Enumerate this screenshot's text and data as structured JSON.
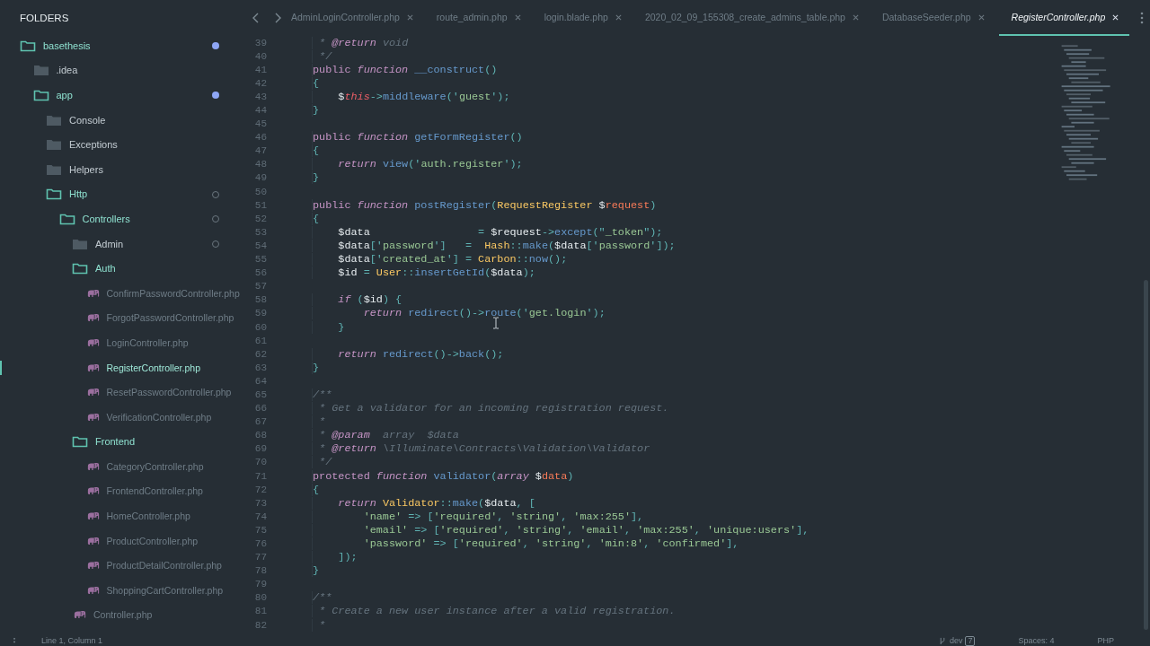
{
  "sidebar": {
    "title": "FOLDERS",
    "tree": [
      {
        "name": "basethesis",
        "kind": "folder",
        "expanded": true,
        "modified": true,
        "children": [
          {
            "name": ".idea",
            "kind": "folder",
            "expanded": false
          },
          {
            "name": "app",
            "kind": "folder",
            "expanded": true,
            "modified": true,
            "children": [
              {
                "name": "Console",
                "kind": "folder",
                "expanded": false
              },
              {
                "name": "Exceptions",
                "kind": "folder",
                "expanded": false
              },
              {
                "name": "Helpers",
                "kind": "folder",
                "expanded": false
              },
              {
                "name": "Http",
                "kind": "folder",
                "expanded": true,
                "modified": false,
                "children": [
                  {
                    "name": "Controllers",
                    "kind": "folder",
                    "expanded": true,
                    "modified": false,
                    "children": [
                      {
                        "name": "Admin",
                        "kind": "folder",
                        "expanded": false,
                        "modified": false
                      },
                      {
                        "name": "Auth",
                        "kind": "folder",
                        "expanded": true,
                        "children": [
                          {
                            "name": "ConfirmPasswordController.php",
                            "kind": "file",
                            "selected": false
                          },
                          {
                            "name": "ForgotPasswordController.php",
                            "kind": "file",
                            "selected": false
                          },
                          {
                            "name": "LoginController.php",
                            "kind": "file",
                            "selected": false
                          },
                          {
                            "name": "RegisterController.php",
                            "kind": "file",
                            "selected": true
                          },
                          {
                            "name": "ResetPasswordController.php",
                            "kind": "file",
                            "selected": false
                          },
                          {
                            "name": "VerificationController.php",
                            "kind": "file",
                            "selected": false
                          }
                        ]
                      },
                      {
                        "name": "Frontend",
                        "kind": "folder",
                        "expanded": true,
                        "children": [
                          {
                            "name": "CategoryController.php",
                            "kind": "file",
                            "selected": false
                          },
                          {
                            "name": "FrontendController.php",
                            "kind": "file",
                            "selected": false
                          },
                          {
                            "name": "HomeController.php",
                            "kind": "file",
                            "selected": false
                          },
                          {
                            "name": "ProductController.php",
                            "kind": "file",
                            "selected": false
                          },
                          {
                            "name": "ProductDetailController.php",
                            "kind": "file",
                            "selected": false
                          },
                          {
                            "name": "ShoppingCartController.php",
                            "kind": "file",
                            "selected": false
                          }
                        ]
                      },
                      {
                        "name": "Controller.php",
                        "kind": "file",
                        "selected": false
                      }
                    ]
                  }
                ]
              }
            ]
          }
        ]
      }
    ]
  },
  "tabs": [
    {
      "label": "AdminLoginController.php",
      "selected": false
    },
    {
      "label": "route_admin.php",
      "selected": false
    },
    {
      "label": "login.blade.php",
      "selected": false
    },
    {
      "label": "2020_02_09_155308_create_admins_table.php",
      "selected": false
    },
    {
      "label": "DatabaseSeeder.php",
      "selected": false
    },
    {
      "label": "RegisterController.php",
      "selected": true
    }
  ],
  "editor": {
    "lines": [
      {
        "number": "39",
        "tokens": [
          {
            "kind": "cmt",
            "text": " * "
          },
          {
            "kind": "tag",
            "text": "@return"
          },
          {
            "kind": "cmt",
            "text": " void"
          }
        ]
      },
      {
        "number": "40",
        "tokens": [
          {
            "kind": "cmt",
            "text": " */"
          }
        ]
      },
      {
        "number": "41",
        "tokens": [
          {
            "kind": "storage",
            "text": "public "
          },
          {
            "kind": "type",
            "text": "function"
          },
          {
            "kind": "fn",
            "text": " __construct"
          },
          {
            "kind": "op",
            "text": "()"
          }
        ]
      },
      {
        "number": "42",
        "tokens": [
          {
            "kind": "op",
            "text": "{"
          }
        ]
      },
      {
        "number": "43",
        "tokens": [
          {
            "kind": "var",
            "text": "    $"
          },
          {
            "kind": "this",
            "text": "this"
          },
          {
            "kind": "op",
            "text": "->"
          },
          {
            "kind": "fn",
            "text": "middleware"
          },
          {
            "kind": "op",
            "text": "('"
          },
          {
            "kind": "str",
            "text": "guest"
          },
          {
            "kind": "op",
            "text": "');"
          }
        ]
      },
      {
        "number": "44",
        "tokens": [
          {
            "kind": "op",
            "text": "}"
          }
        ]
      },
      {
        "number": "45"
      },
      {
        "number": "46",
        "tokens": [
          {
            "kind": "storage",
            "text": "public "
          },
          {
            "kind": "type",
            "text": "function"
          },
          {
            "kind": "fn",
            "text": " getFormRegister"
          },
          {
            "kind": "op",
            "text": "()"
          }
        ]
      },
      {
        "number": "47",
        "tokens": [
          {
            "kind": "op",
            "text": "{"
          }
        ]
      },
      {
        "number": "48",
        "tokens": [
          {
            "kind": "type",
            "text": "    return"
          },
          {
            "kind": "fn",
            "text": " view"
          },
          {
            "kind": "op",
            "text": "('"
          },
          {
            "kind": "str",
            "text": "auth.register"
          },
          {
            "kind": "op",
            "text": "');"
          }
        ]
      },
      {
        "number": "49",
        "tokens": [
          {
            "kind": "op",
            "text": "}"
          }
        ]
      },
      {
        "number": "50"
      },
      {
        "number": "51",
        "tokens": [
          {
            "kind": "storage",
            "text": "public "
          },
          {
            "kind": "type",
            "text": "function"
          },
          {
            "kind": "fn",
            "text": " postRegister"
          },
          {
            "kind": "op",
            "text": "("
          },
          {
            "kind": "cls",
            "text": "RequestRegister "
          },
          {
            "kind": "var",
            "text": "$"
          },
          {
            "kind": "param",
            "text": "request"
          },
          {
            "kind": "op",
            "text": ")"
          }
        ]
      },
      {
        "number": "52",
        "tokens": [
          {
            "kind": "op",
            "text": "{"
          }
        ]
      },
      {
        "number": "53",
        "tokens": [
          {
            "kind": "var",
            "text": "    $data                 "
          },
          {
            "kind": "op",
            "text": "= "
          },
          {
            "kind": "var",
            "text": "$request"
          },
          {
            "kind": "op",
            "text": "->"
          },
          {
            "kind": "fn",
            "text": "except"
          },
          {
            "kind": "op",
            "text": "(\""
          },
          {
            "kind": "str",
            "text": "_token"
          },
          {
            "kind": "op",
            "text": "\");"
          }
        ]
      },
      {
        "number": "54",
        "tokens": [
          {
            "kind": "var",
            "text": "    $data"
          },
          {
            "kind": "op",
            "text": "['"
          },
          {
            "kind": "str",
            "text": "password"
          },
          {
            "kind": "op",
            "text": "']   =  "
          },
          {
            "kind": "cls",
            "text": "Hash"
          },
          {
            "kind": "op",
            "text": "::"
          },
          {
            "kind": "fn",
            "text": "make"
          },
          {
            "kind": "op",
            "text": "("
          },
          {
            "kind": "var",
            "text": "$data"
          },
          {
            "kind": "op",
            "text": "['"
          },
          {
            "kind": "str",
            "text": "password"
          },
          {
            "kind": "op",
            "text": "']);"
          }
        ]
      },
      {
        "number": "55",
        "tokens": [
          {
            "kind": "var",
            "text": "    $data"
          },
          {
            "kind": "op",
            "text": "['"
          },
          {
            "kind": "str",
            "text": "created_at"
          },
          {
            "kind": "op",
            "text": "'] = "
          },
          {
            "kind": "cls",
            "text": "Carbon"
          },
          {
            "kind": "op",
            "text": "::"
          },
          {
            "kind": "fn",
            "text": "now"
          },
          {
            "kind": "op",
            "text": "();"
          }
        ]
      },
      {
        "number": "56",
        "tokens": [
          {
            "kind": "var",
            "text": "    $id "
          },
          {
            "kind": "op",
            "text": "= "
          },
          {
            "kind": "cls",
            "text": "User"
          },
          {
            "kind": "op",
            "text": "::"
          },
          {
            "kind": "fn",
            "text": "insertGetId"
          },
          {
            "kind": "op",
            "text": "("
          },
          {
            "kind": "var",
            "text": "$data"
          },
          {
            "kind": "op",
            "text": ");"
          }
        ]
      },
      {
        "number": "57"
      },
      {
        "number": "58",
        "tokens": [
          {
            "kind": "type",
            "text": "    if"
          },
          {
            "kind": "op",
            "text": " ("
          },
          {
            "kind": "var",
            "text": "$id"
          },
          {
            "kind": "op",
            "text": ") {"
          }
        ]
      },
      {
        "number": "59",
        "tokens": [
          {
            "kind": "type",
            "text": "        return"
          },
          {
            "kind": "fn",
            "text": " redirect"
          },
          {
            "kind": "op",
            "text": "()->"
          },
          {
            "kind": "fn",
            "text": "route"
          },
          {
            "kind": "op",
            "text": "('"
          },
          {
            "kind": "str",
            "text": "get.login"
          },
          {
            "kind": "op",
            "text": "');"
          }
        ]
      },
      {
        "number": "60",
        "tokens": [
          {
            "kind": "op",
            "text": "    }"
          }
        ]
      },
      {
        "number": "61"
      },
      {
        "number": "62",
        "tokens": [
          {
            "kind": "type",
            "text": "    return"
          },
          {
            "kind": "fn",
            "text": " redirect"
          },
          {
            "kind": "op",
            "text": "()->"
          },
          {
            "kind": "fn",
            "text": "back"
          },
          {
            "kind": "op",
            "text": "();"
          }
        ]
      },
      {
        "number": "63",
        "tokens": [
          {
            "kind": "op",
            "text": "}"
          }
        ]
      },
      {
        "number": "64"
      },
      {
        "number": "65",
        "tokens": [
          {
            "kind": "cmt",
            "text": "/**"
          }
        ]
      },
      {
        "number": "66",
        "tokens": [
          {
            "kind": "cmt",
            "text": " * Get a validator for an incoming registration request."
          }
        ]
      },
      {
        "number": "67",
        "tokens": [
          {
            "kind": "cmt",
            "text": " *"
          }
        ]
      },
      {
        "number": "68",
        "tokens": [
          {
            "kind": "cmt",
            "text": " * "
          },
          {
            "kind": "tag",
            "text": "@param"
          },
          {
            "kind": "cmt",
            "text": "  array  $data"
          }
        ]
      },
      {
        "number": "69",
        "tokens": [
          {
            "kind": "cmt",
            "text": " * "
          },
          {
            "kind": "tag",
            "text": "@return"
          },
          {
            "kind": "cmt",
            "text": " \\Illuminate\\Contracts\\Validation\\Validator"
          }
        ]
      },
      {
        "number": "70",
        "tokens": [
          {
            "kind": "cmt",
            "text": " */"
          }
        ]
      },
      {
        "number": "71",
        "tokens": [
          {
            "kind": "storage",
            "text": "protected "
          },
          {
            "kind": "type",
            "text": "function"
          },
          {
            "kind": "fn",
            "text": " validator"
          },
          {
            "kind": "op",
            "text": "("
          },
          {
            "kind": "type",
            "text": "array"
          },
          {
            "kind": "var",
            "text": " $"
          },
          {
            "kind": "param",
            "text": "data"
          },
          {
            "kind": "op",
            "text": ")"
          }
        ]
      },
      {
        "number": "72",
        "tokens": [
          {
            "kind": "op",
            "text": "{"
          }
        ]
      },
      {
        "number": "73",
        "tokens": [
          {
            "kind": "type",
            "text": "    return "
          },
          {
            "kind": "cls",
            "text": "Validator"
          },
          {
            "kind": "op",
            "text": "::"
          },
          {
            "kind": "fn",
            "text": "make"
          },
          {
            "kind": "op",
            "text": "("
          },
          {
            "kind": "var",
            "text": "$data"
          },
          {
            "kind": "op",
            "text": ", ["
          }
        ]
      },
      {
        "number": "74",
        "tokens": [
          {
            "kind": "str",
            "text": "        'name'"
          },
          {
            "kind": "op",
            "text": " => ["
          },
          {
            "kind": "str",
            "text": "'required'"
          },
          {
            "kind": "op",
            "text": ", "
          },
          {
            "kind": "str",
            "text": "'string'"
          },
          {
            "kind": "op",
            "text": ", "
          },
          {
            "kind": "str",
            "text": "'max:255'"
          },
          {
            "kind": "op",
            "text": "],"
          }
        ]
      },
      {
        "number": "75",
        "tokens": [
          {
            "kind": "str",
            "text": "        'email'"
          },
          {
            "kind": "op",
            "text": " => ["
          },
          {
            "kind": "str",
            "text": "'required'"
          },
          {
            "kind": "op",
            "text": ", "
          },
          {
            "kind": "str",
            "text": "'string'"
          },
          {
            "kind": "op",
            "text": ", "
          },
          {
            "kind": "str",
            "text": "'email'"
          },
          {
            "kind": "op",
            "text": ", "
          },
          {
            "kind": "str",
            "text": "'max:255'"
          },
          {
            "kind": "op",
            "text": ", "
          },
          {
            "kind": "str",
            "text": "'unique:users'"
          },
          {
            "kind": "op",
            "text": "],"
          }
        ]
      },
      {
        "number": "76",
        "tokens": [
          {
            "kind": "str",
            "text": "        'password'"
          },
          {
            "kind": "op",
            "text": " => ["
          },
          {
            "kind": "str",
            "text": "'required'"
          },
          {
            "kind": "op",
            "text": ", "
          },
          {
            "kind": "str",
            "text": "'string'"
          },
          {
            "kind": "op",
            "text": ", "
          },
          {
            "kind": "str",
            "text": "'min:8'"
          },
          {
            "kind": "op",
            "text": ", "
          },
          {
            "kind": "str",
            "text": "'confirmed'"
          },
          {
            "kind": "op",
            "text": "],"
          }
        ]
      },
      {
        "number": "77",
        "tokens": [
          {
            "kind": "op",
            "text": "    ]);"
          }
        ]
      },
      {
        "number": "78",
        "tokens": [
          {
            "kind": "op",
            "text": "}"
          }
        ]
      },
      {
        "number": "79"
      },
      {
        "number": "80",
        "tokens": [
          {
            "kind": "cmt",
            "text": "/**"
          }
        ]
      },
      {
        "number": "81",
        "tokens": [
          {
            "kind": "cmt",
            "text": " * Create a new user instance after a valid registration."
          }
        ]
      },
      {
        "number": "82",
        "tokens": [
          {
            "kind": "cmt",
            "text": " *"
          }
        ]
      }
    ]
  },
  "status_bar": {
    "position": "Line 1, Column 1",
    "branch": "dev",
    "changes": "7",
    "indentation": "Spaces: 4",
    "syntax": "PHP"
  }
}
